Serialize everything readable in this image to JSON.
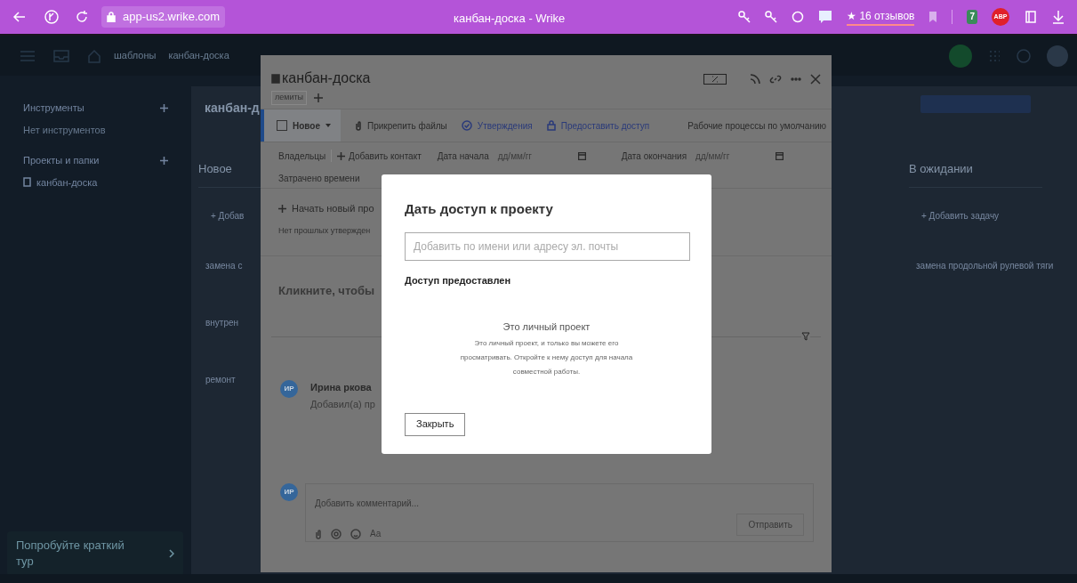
{
  "browser": {
    "url": "app-us2.wrike.com",
    "title": "канбан-доска - Wrike",
    "reviews": "★ 16 отзывов",
    "badge_count": "7",
    "adblock": "ABP"
  },
  "app": {
    "breadcrumb": [
      "шаблоны",
      "канбан-доска"
    ],
    "sidebar": {
      "sections": [
        {
          "title": "Инструменты",
          "empty": "Нет инструментов"
        },
        {
          "title": "Проекты и папки",
          "items": [
            "канбан-доска"
          ]
        }
      ],
      "tour": "Попробуйте краткий тур"
    },
    "board": {
      "title": "канбан-д",
      "columns": [
        {
          "name": "Новое",
          "add": "+ Добав",
          "cards": [
            "замена с",
            "внутрен",
            "ремонт"
          ]
        },
        {
          "name": "В ожидании",
          "add": "+ Добавить задачу",
          "cards": [
            "замена продольной рулевой тяги"
          ]
        }
      ]
    }
  },
  "task": {
    "title": "канбан-доска",
    "tag": "лемиты",
    "status": "Новое",
    "toolbar": [
      {
        "label": "Прикрепить файлы",
        "kind": "attach"
      },
      {
        "label": "Утверждения",
        "kind": "approval"
      },
      {
        "label": "Предоставить доступ",
        "kind": "share"
      }
    ],
    "workflow": "Рабочие процессы по умолчанию",
    "fields": {
      "owners": "Владельцы",
      "add_contact": "Добавить контакт",
      "start_label": "Дата начала",
      "start_placeholder": "дд/мм/гг",
      "end_label": "Дата окончания",
      "end_placeholder": "дд/мм/гг",
      "time_spent": "Затрачено времени"
    },
    "approval": {
      "start": "Начать новый про",
      "none": "Нет прошлых утвержден"
    },
    "description_placeholder": "Кликните, чтобы",
    "activity": [
      {
        "initials": "ИР",
        "author": "Ирина ркова",
        "text": "Добавил(а) пр"
      }
    ],
    "comment": {
      "initials": "ИР",
      "placeholder": "Добавить комментарий...",
      "format": "Aa",
      "send": "Отправить"
    }
  },
  "dialog": {
    "title": "Дать доступ к проекту",
    "input_placeholder": "Добавить по имени или адресу эл. почты",
    "section": "Доступ предоставлен",
    "empty_title": "Это личный проект",
    "empty_text": "Это личный проект, и только вы можете его просматривать. Откройте к нему доступ для начала совместной работы.",
    "close": "Закрыть"
  }
}
